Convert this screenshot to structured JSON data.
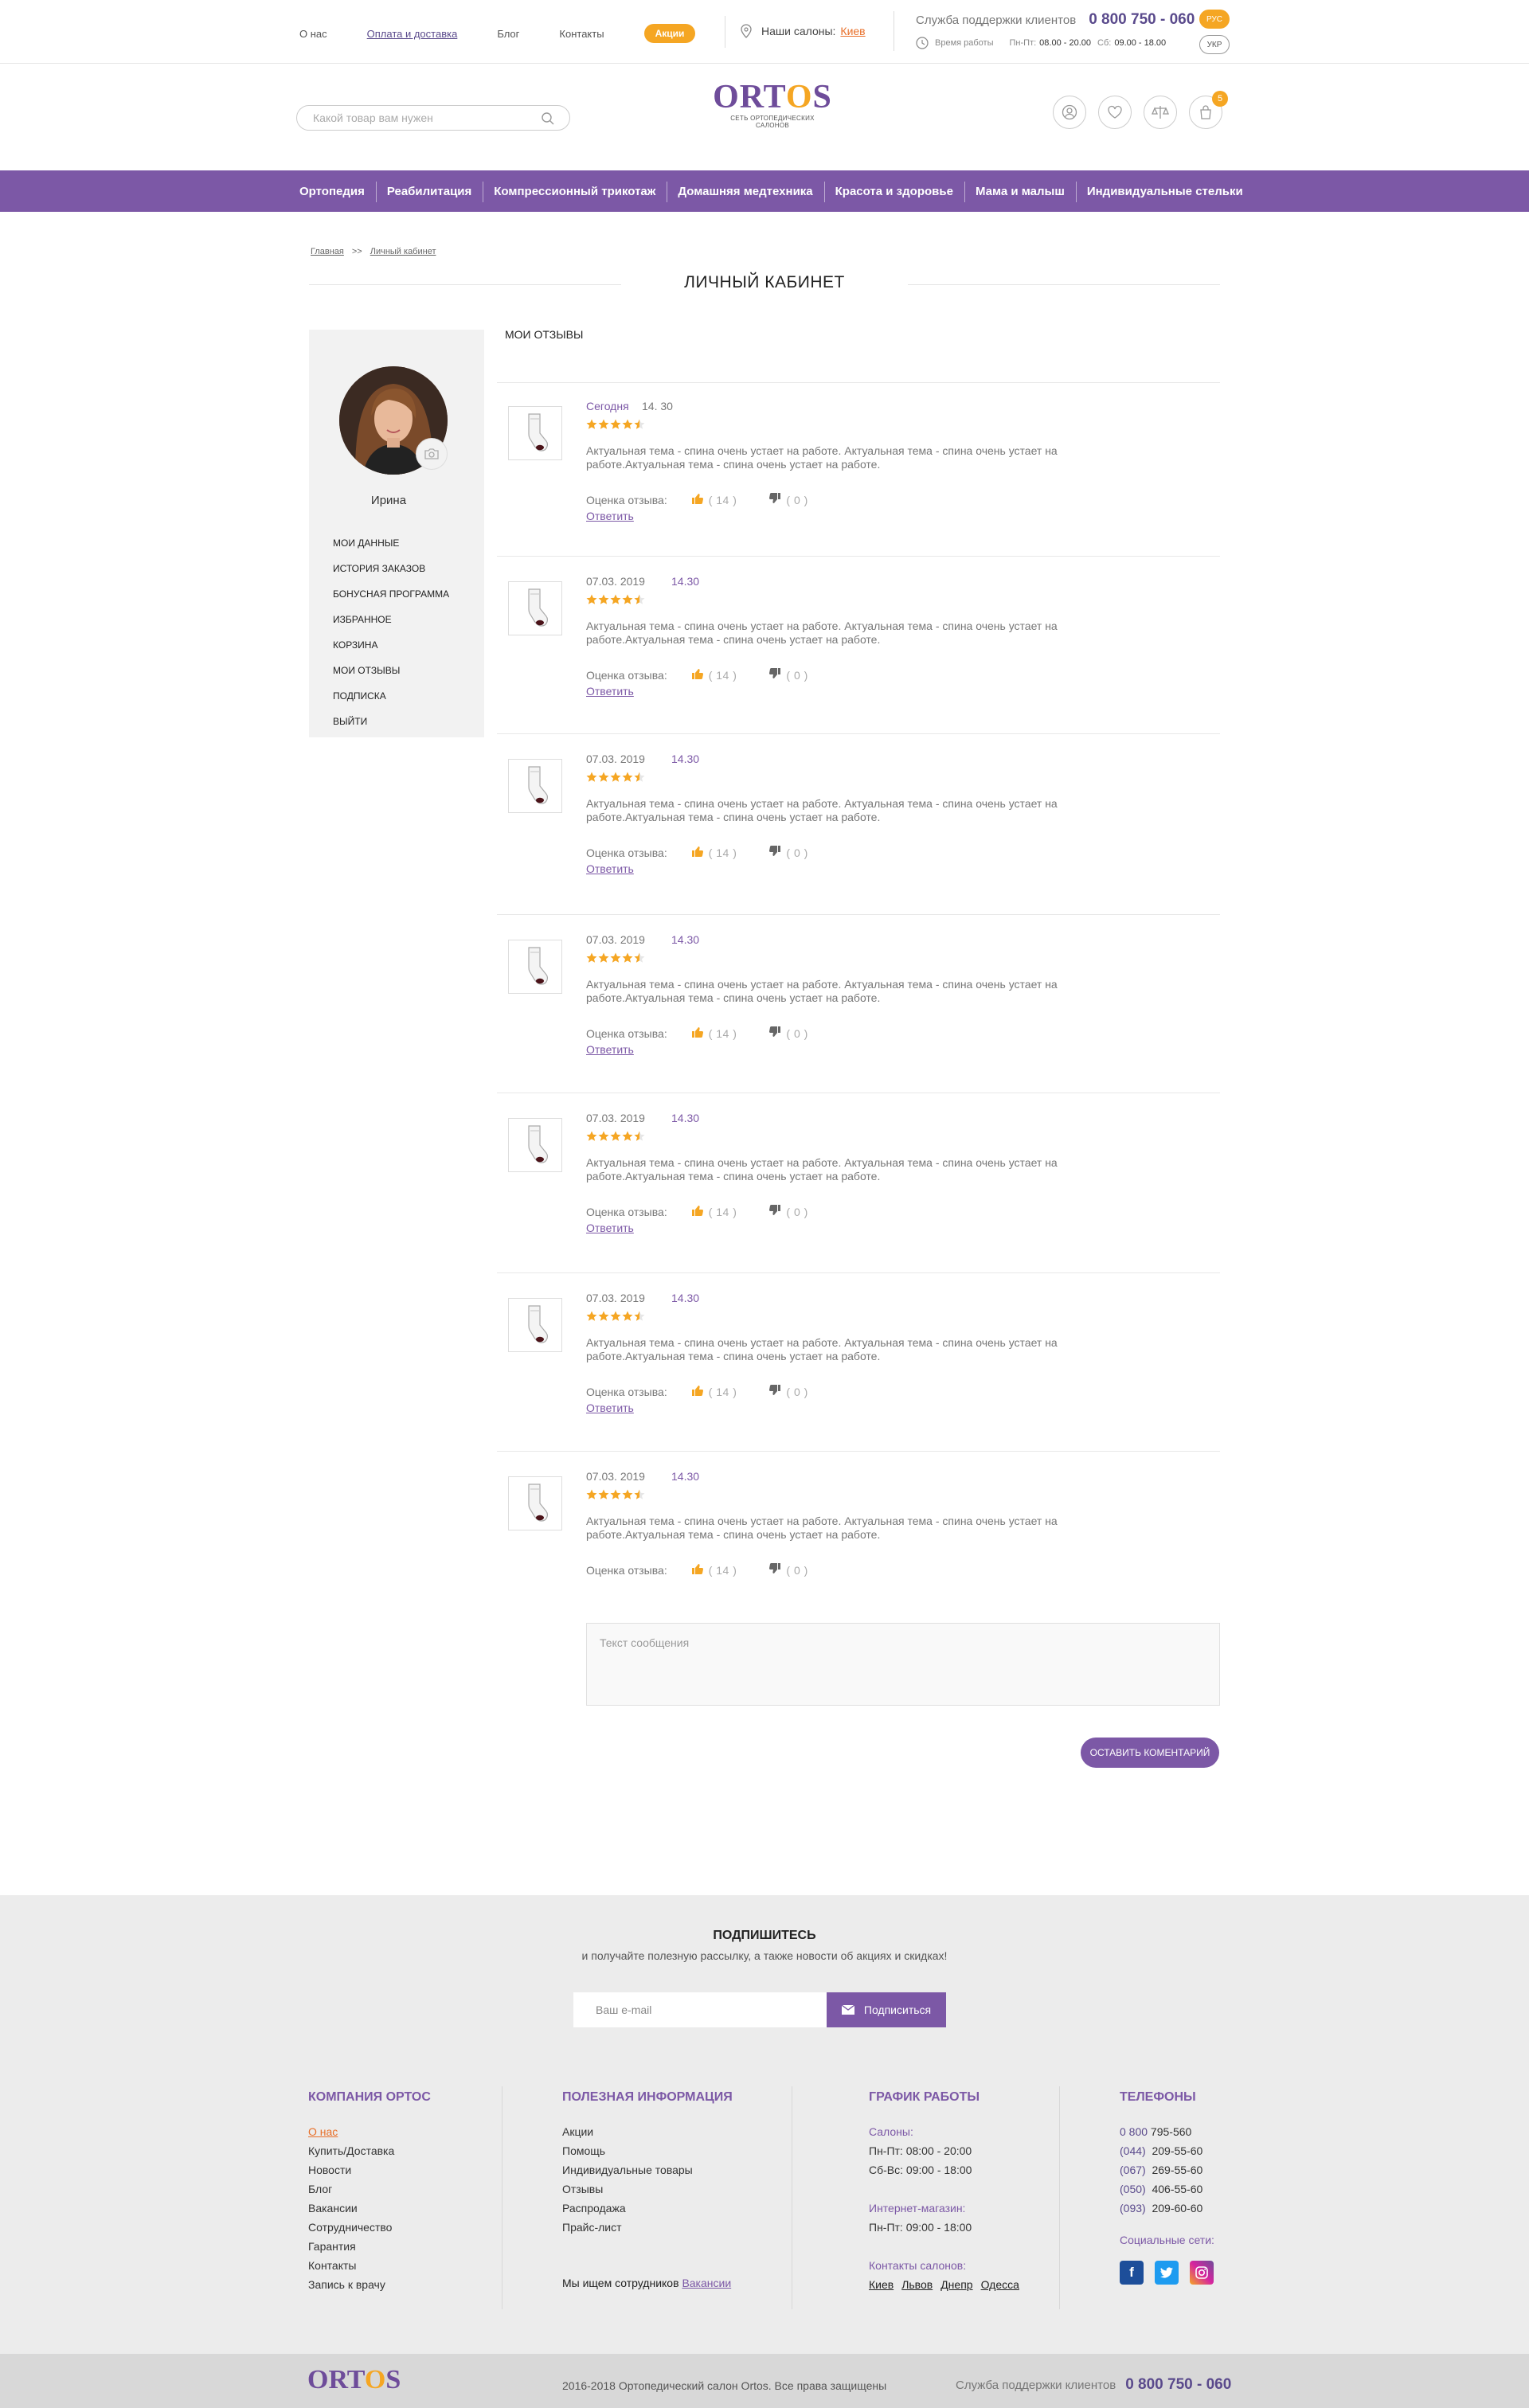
{
  "topbar": {
    "links": [
      "О нас",
      "Оплата и доставка",
      "Блог",
      "Контакты"
    ],
    "promo": "Акции",
    "salons_label": "Наши салоны:",
    "city": "Киев",
    "support_label": "Служба поддержки клиентов",
    "phone": "0 800 750 - 060",
    "hours_label": "Время работы",
    "hours_weekdays_label": "Пн-Пт:",
    "hours_weekdays": "08.00 - 20.00",
    "hours_sat_label": "Сб:",
    "hours_sat": "09.00 - 18.00",
    "lang_ru": "РУС",
    "lang_ua": "УКР"
  },
  "header": {
    "search_placeholder": "Какой товар вам нужен",
    "logo_text_pre": "ORT",
    "logo_text_o": "O",
    "logo_text_post": "S",
    "logo_sub": "СЕТЬ ОРТОПЕДИЧЕСКИХ САЛОНОВ",
    "cart_count": "5"
  },
  "nav": {
    "items": [
      "Ортопедия",
      "Реабилитация",
      "Компрессионный трикотаж",
      "Домашняя медтехника",
      "Красота и здоровье",
      "Мама и малыш",
      "Индивидуальные стельки"
    ]
  },
  "breadcrumb": {
    "home": "Главная",
    "sep": ">>",
    "current": "Личный кабинет"
  },
  "page": {
    "title": "ЛИЧНЫЙ КАБИНЕТ",
    "section": "МОИ ОТЗЫВЫ"
  },
  "sidebar": {
    "user_name": "Ирина",
    "menu": [
      "Мои  данные",
      "История заказов",
      "Бонусная программа",
      "Избранное",
      "Корзина",
      "Мои отзывы",
      "Подписка",
      "Выйти"
    ]
  },
  "reviews": [
    {
      "date": "Сегодня",
      "time": "14. 30",
      "rating": 4.5,
      "text": "Актуальная тема - спина очень устает на работе. Актуальная тема - спина очень устает на работе.Актуальная тема - спина очень устает на работе.",
      "rate_label": "Оценка отзыва:",
      "likes": "( 14 )",
      "dislikes": "( 0 )",
      "reply": "Ответить"
    },
    {
      "date": "07.03. 2019",
      "time": "14.30",
      "rating": 4.5,
      "text": "Актуальная тема - спина очень устает на работе. Актуальная тема - спина очень устает на работе.Актуальная тема - спина очень устает на работе.",
      "rate_label": "Оценка отзыва:",
      "likes": "( 14 )",
      "dislikes": "( 0 )",
      "reply": "Ответить"
    },
    {
      "date": "07.03. 2019",
      "time": "14.30",
      "rating": 4.5,
      "text": "Актуальная тема - спина очень устает на работе. Актуальная тема - спина очень устает на работе.Актуальная тема - спина очень устает на работе.",
      "rate_label": "Оценка отзыва:",
      "likes": "( 14 )",
      "dislikes": "( 0 )",
      "reply": "Ответить"
    },
    {
      "date": "07.03. 2019",
      "time": "14.30",
      "rating": 4.5,
      "text": "Актуальная тема - спина очень устает на работе. Актуальная тема - спина очень устает на работе.Актуальная тема - спина очень устает на работе.",
      "rate_label": "Оценка отзыва:",
      "likes": "( 14 )",
      "dislikes": "( 0 )",
      "reply": "Ответить"
    },
    {
      "date": "07.03. 2019",
      "time": "14.30",
      "rating": 4.5,
      "text": "Актуальная тема - спина очень устает на работе. Актуальная тема - спина очень устает на работе.Актуальная тема - спина очень устает на работе.",
      "rate_label": "Оценка отзыва:",
      "likes": "( 14 )",
      "dislikes": "( 0 )",
      "reply": "Ответить"
    },
    {
      "date": "07.03. 2019",
      "time": "14.30",
      "rating": 4.5,
      "text": "Актуальная тема - спина очень устает на работе. Актуальная тема - спина очень устает на работе.Актуальная тема - спина очень устает на работе.",
      "rate_label": "Оценка отзыва:",
      "likes": "( 14 )",
      "dislikes": "( 0 )",
      "reply": "Ответить"
    },
    {
      "date": "07.03. 2019",
      "time": "14.30",
      "rating": 4.5,
      "text": "Актуальная тема - спина очень устает на работе. Актуальная тема - спина очень устает на работе.Актуальная тема - спина очень устает на работе.",
      "rate_label": "Оценка отзыва:",
      "likes": "( 14 )",
      "dislikes": "( 0 )",
      "reply": ""
    }
  ],
  "comment": {
    "placeholder": "Текст сообщения",
    "button": "Оставить коментарий"
  },
  "subscribe": {
    "title": "ПОДПИШИТЕСЬ",
    "text": "и получайте полезную рассылку, а также новости об акциях и скидках!",
    "email_placeholder": "Ваш e-mail",
    "button": "Подписиться"
  },
  "footer": {
    "company": {
      "title": "КОМПАНИЯ ОРТОС",
      "links": [
        "О нас",
        "Купить/Доставка",
        "Новости",
        "Блог",
        "Вакансии",
        "Сотрудничество",
        "Гарантия",
        "Контакты",
        "Запись к врачу"
      ]
    },
    "info": {
      "title": "ПОЛЕЗНАЯ ИНФОРМАЦИЯ",
      "links": [
        "Акции",
        "Помощь",
        "Индивидуальные товары",
        "Отзывы",
        "Распродажа",
        "Прайс-лист"
      ],
      "jobs_text": "Мы ищем сотрудников",
      "jobs_link": "Вакансии"
    },
    "schedule": {
      "title": "ГРАФИК РАБОТЫ",
      "salons_label": "Салоны:",
      "salons_weekdays": "Пн-Пт: 08:00 - 20:00",
      "salons_weekend": "Сб-Вс: 09:00 - 18:00",
      "shop_label": "Интернет-магазин:",
      "shop_hours": "Пн-Пт: 09:00 - 18:00",
      "contacts_label": "Контакты салонов:",
      "cities": [
        "Киев",
        "Львов",
        "Днепр",
        "Одесса"
      ]
    },
    "phones": {
      "title": "ТЕЛЕФОНЫ",
      "list": [
        {
          "code": "0 800",
          "num": " 795-560"
        },
        {
          "code": "(044)",
          "num": "  209-55-60"
        },
        {
          "code": "(067)",
          "num": "  269-55-60"
        },
        {
          "code": "(050)",
          "num": "  406-55-60"
        },
        {
          "code": "(093)",
          "num": "  209-60-60"
        }
      ],
      "social_label": "Социальные сети:"
    }
  },
  "bottom": {
    "logo_pre": "ORT",
    "logo_o": "O",
    "logo_post": "S",
    "copyright": "2016-2018  Ортопедический салон Ortos. Все права защищены",
    "support_label": "Служба поддержки клиентов",
    "phone": "0 800 750 - 060"
  },
  "colors": {
    "accent": "#7c58a6",
    "orange": "#f5a623",
    "footer_bg": "#ececec"
  }
}
